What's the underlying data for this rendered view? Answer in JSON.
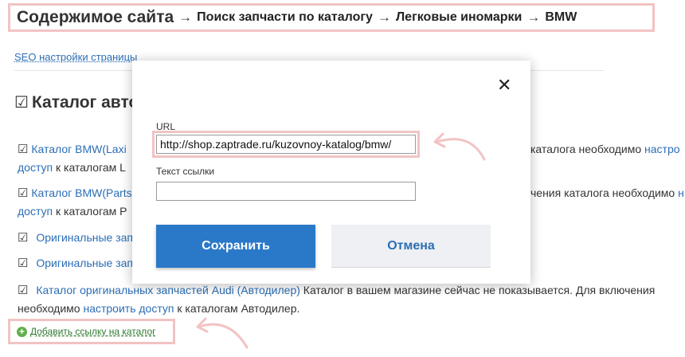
{
  "breadcrumb": {
    "root": "Содержимое сайта",
    "separator": "→",
    "items": [
      "Поиск запчасти по каталогу",
      "Легковые иномарки",
      "BMW"
    ]
  },
  "seo_link": "SEO настройки страницы",
  "section_title": "Каталог авто",
  "checkbox_glyph": "☑",
  "rows": [
    {
      "link": "Каталог BMW(Laxi",
      "right": "каталога необходимо ",
      "right_link": "настро",
      "line2_link": "доступ",
      "line2_text": " к каталогам L"
    },
    {
      "link": "Каталог BMW(Parts",
      "right": "чения каталога необходимо ",
      "right_link": "н",
      "line2_link": "доступ",
      "line2_text": " к каталогам P"
    },
    {
      "link": "Оригинальные зап"
    },
    {
      "link": "Оригинальные зап"
    },
    {
      "link": "Каталог оригинальных запчастей Audi (Автодилер)",
      "right": " Каталог в вашем магазине сейчас не показывается. Для включения",
      "line2_text_pre": "необходимо ",
      "line2_link": "настроить доступ",
      "line2_text": " к каталогам Автодилер."
    }
  ],
  "add_link": "Добавить ссылку на каталог",
  "modal": {
    "close_glyph": "✕",
    "url_label": "URL",
    "url_value": "http://shop.zaptrade.ru/kuzovnoy-katalog/bmw/",
    "text_label": "Текст ссылки",
    "text_value": "",
    "save_label": "Сохранить",
    "cancel_label": "Отмена"
  },
  "colors": {
    "accent": "#2a79c9",
    "link": "#2c6eb5",
    "highlight": "#f2c3c3",
    "add_green": "#5fb04a"
  }
}
